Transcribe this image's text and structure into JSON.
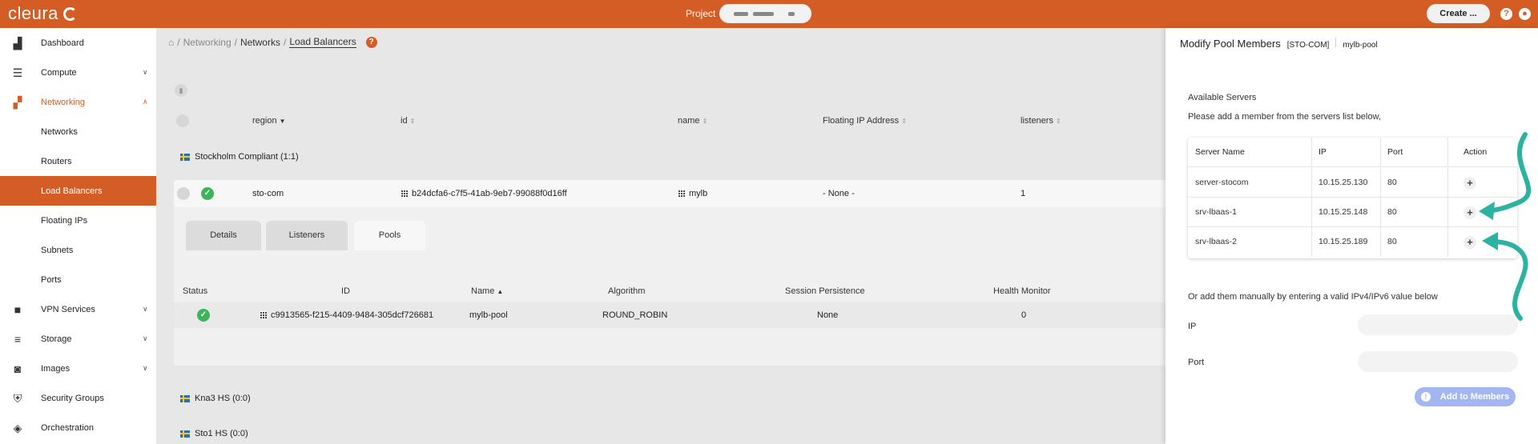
{
  "topbar": {
    "logo_text": "cleura",
    "project_label": "Project",
    "create_label": "Create ...",
    "help_icon": "?",
    "user_icon": "user-icon"
  },
  "sidebar": {
    "items": [
      {
        "label": "Dashboard",
        "icon": "chart-icon"
      },
      {
        "label": "Compute",
        "icon": "server-icon"
      },
      {
        "label": "Networking",
        "icon": "network-icon"
      },
      {
        "label": "Networks"
      },
      {
        "label": "Routers"
      },
      {
        "label": "Load Balancers"
      },
      {
        "label": "Floating IPs"
      },
      {
        "label": "Subnets"
      },
      {
        "label": "Ports"
      },
      {
        "label": "VPN Services",
        "icon": "lock-icon"
      },
      {
        "label": "Storage",
        "icon": "database-icon"
      },
      {
        "label": "Images",
        "icon": "camera-icon"
      },
      {
        "label": "Security Groups",
        "icon": "shield-icon"
      },
      {
        "label": "Orchestration",
        "icon": "orchestration-icon"
      }
    ]
  },
  "breadcrumb": {
    "sep": "/",
    "networking": "Networking",
    "networks": "Networks",
    "load_balancers": "Load Balancers"
  },
  "table": {
    "headers": {
      "region": "region",
      "id": "id",
      "name": "name",
      "floating_ip": "Floating IP Address",
      "listeners": "listeners"
    },
    "groups": {
      "stockholm": "Stockholm Compliant (1:1)",
      "kna3": "Kna3 HS (0:0)",
      "sto1": "Sto1 HS (0:0)"
    },
    "row": {
      "region": "sto-com",
      "id": "b24dcfa6-c7f5-41ab-9eb7-99088f0d16ff",
      "name": "mylb",
      "floating_ip": "- None -",
      "listeners": "1"
    }
  },
  "tabs": {
    "details": "Details",
    "listeners": "Listeners",
    "pools": "Pools"
  },
  "pools": {
    "headers": {
      "status": "Status",
      "id": "ID",
      "name": "Name",
      "algorithm": "Algorithm",
      "session": "Session Persistence",
      "health": "Health Monitor"
    },
    "row": {
      "id": "c9913565-f215-4409-9484-305dcf726681",
      "name": "mylb-pool",
      "algorithm": "ROUND_ROBIN",
      "session": "None",
      "health": "0"
    }
  },
  "panel": {
    "title": "Modify Pool Members",
    "region_tag": "[STO-COM]",
    "pool_tag": "mylb-pool",
    "available_servers": "Available Servers",
    "instruction": "Please add a member from the servers list below,",
    "servers_headers": {
      "name": "Server Name",
      "ip": "IP",
      "port": "Port",
      "action": "Action"
    },
    "servers": [
      {
        "name": "server-stocom",
        "ip": "10.15.25.130",
        "port": "80"
      },
      {
        "name": "srv-lbaas-1",
        "ip": "10.15.25.148",
        "port": "80"
      },
      {
        "name": "srv-lbaas-2",
        "ip": "10.15.25.189",
        "port": "80"
      }
    ],
    "manual_text": "Or add them manually by entering a valid IPv4/IPv6 value below",
    "ip_label": "IP",
    "port_label": "Port",
    "add_button": "Add to Members",
    "arrow_color": "#2ab3a0"
  },
  "colors": {
    "brand": "#d45d25",
    "success": "#3cb55a",
    "button_disabled": "#a3b6f2"
  }
}
